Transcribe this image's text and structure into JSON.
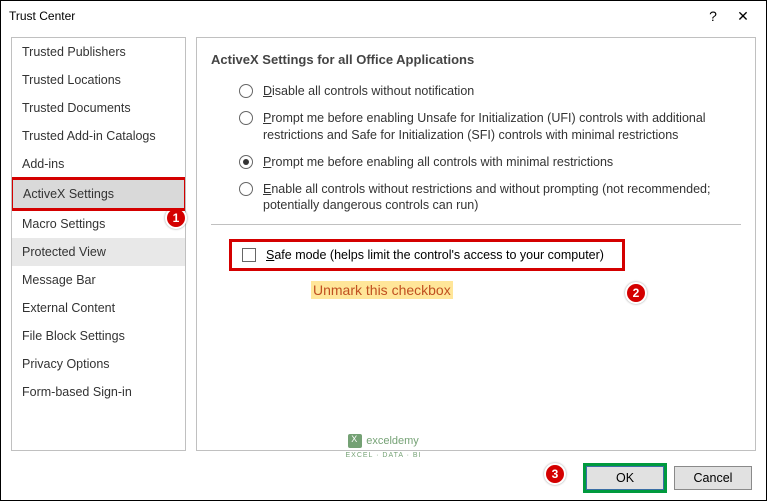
{
  "window": {
    "title": "Trust Center"
  },
  "sidebar": {
    "items": [
      {
        "label": "Trusted Publishers"
      },
      {
        "label": "Trusted Locations"
      },
      {
        "label": "Trusted Documents"
      },
      {
        "label": "Trusted Add-in Catalogs"
      },
      {
        "label": "Add-ins"
      },
      {
        "label": "ActiveX Settings"
      },
      {
        "label": "Macro Settings"
      },
      {
        "label": "Protected View"
      },
      {
        "label": "Message Bar"
      },
      {
        "label": "External Content"
      },
      {
        "label": "File Block Settings"
      },
      {
        "label": "Privacy Options"
      },
      {
        "label": "Form-based Sign-in"
      }
    ]
  },
  "content": {
    "section_title": "ActiveX Settings for all Office Applications",
    "radios": [
      {
        "label": "Disable all controls without notification",
        "underline_first": "D"
      },
      {
        "label": "Prompt me before enabling Unsafe for Initialization (UFI) controls with additional restrictions and Safe for Initialization (SFI) controls with minimal restrictions",
        "underline_first": "P"
      },
      {
        "label": "Prompt me before enabling all controls with minimal restrictions",
        "underline_first": "P"
      },
      {
        "label": "Enable all controls without restrictions and without prompting (not recommended; potentially dangerous controls can run)",
        "underline_first": "E"
      }
    ],
    "selected_radio": 2,
    "safemode": {
      "label": "Safe mode (helps limit the control's access to your computer)",
      "underline_first": "S",
      "checked": false
    },
    "annotation": "Unmark this checkbox"
  },
  "callouts": {
    "c1": "1",
    "c2": "2",
    "c3": "3"
  },
  "footer": {
    "ok": "OK",
    "cancel": "Cancel"
  },
  "watermark": {
    "brand": "exceldemy",
    "sub": "EXCEL · DATA · BI"
  }
}
